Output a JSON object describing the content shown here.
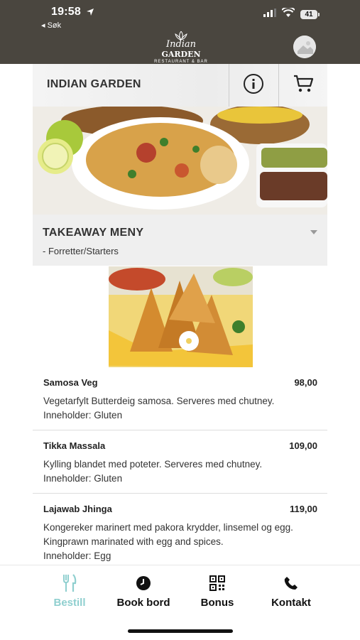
{
  "status_bar": {
    "time": "19:58",
    "back_label": "◂ Søk",
    "battery": "41"
  },
  "brand": {
    "logo_line1": "Indian",
    "logo_line2": "GARDEN",
    "logo_line3": "RESTAURANT & BAR"
  },
  "header": {
    "restaurant_name": "INDIAN GARDEN"
  },
  "section": {
    "title": "TAKEAWAY MENY",
    "subtitle": "- Forretter/Starters"
  },
  "menu": [
    {
      "name": "Samosa Veg",
      "price": "98,00",
      "description": "Vegetarfylt Butterdeig samosa. Serveres med chutney.",
      "contains": "Inneholder: Gluten"
    },
    {
      "name": "Tikka Massala",
      "price": "109,00",
      "description": "Kylling blandet med poteter. Serveres med chutney.",
      "contains": "Inneholder: Gluten"
    },
    {
      "name": "Lajawab Jhinga",
      "price": "119,00",
      "description": "Kongereker marinert med pakora krydder, linsemel og egg. Kingprawn marinated with egg and spices.",
      "contains": "Inneholder: Egg"
    }
  ],
  "tabs": [
    {
      "label": "Bestill",
      "icon": "fork-knife-icon",
      "active": true
    },
    {
      "label": "Book bord",
      "icon": "clock-icon"
    },
    {
      "label": "Bonus",
      "icon": "qr-code-icon"
    },
    {
      "label": "Kontakt",
      "icon": "phone-icon"
    }
  ],
  "colors": {
    "topbar": "#4a463f",
    "active_tab": "#8fcfcf"
  }
}
